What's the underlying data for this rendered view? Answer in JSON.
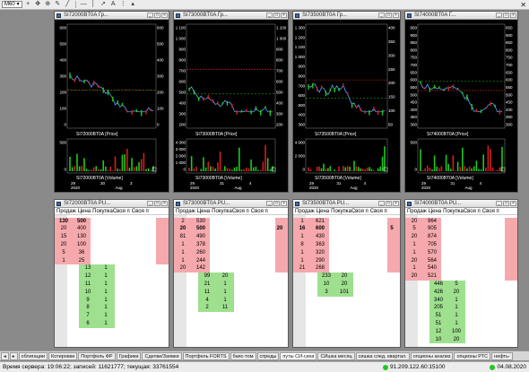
{
  "toolbar": {
    "timeframe": "M60"
  },
  "windows": [
    {
      "title": "SI72000BT0A Гр...",
      "price_legend": "SI72000BT0A [Price]",
      "volume_legend": "SI72000BT0A [Volume]",
      "price_ticks_left": [
        "600",
        "500",
        "400",
        "300",
        "200",
        "100",
        "0"
      ],
      "price_ticks_right": [
        "600",
        "500",
        "400",
        "300",
        "200",
        "100",
        "0"
      ],
      "vol_ticks": [
        "500",
        "0"
      ],
      "date_ticks": [
        "29",
        "30",
        "3"
      ],
      "date_bottom": [
        "2020",
        "Aug"
      ]
    },
    {
      "title": "SI73000BT0A Гр...",
      "price_legend": "SI73000BT0A [Price]",
      "volume_legend": "SI73000BT0A [Volume]",
      "price_ticks_left": [
        "1 100",
        "1 000",
        "900",
        "800",
        "700",
        "600",
        "500",
        "400",
        "300",
        "200"
      ],
      "price_ticks_right": [
        "1 100",
        "1 000",
        "900",
        "800",
        "700",
        "600",
        "500",
        "400",
        "300",
        "200"
      ],
      "vol_ticks": [
        "4 000",
        "3 000",
        "2 000",
        "1 000",
        "0"
      ],
      "date_ticks": [
        "29",
        "31",
        "4"
      ],
      "date_bottom": [
        "2020",
        "Aug"
      ]
    },
    {
      "title": "SI73500BT0A Гр...",
      "price_legend": "SI73500BT0A [Price]",
      "volume_legend": "SI73500BT0A [Volume]",
      "price_ticks_left": [
        "1 300",
        "1 200",
        "1 100",
        "1 000",
        "900",
        "800",
        "700",
        "600",
        "500",
        "400",
        "300"
      ],
      "price_ticks_right": [
        "400",
        "350",
        "300",
        "250",
        "200",
        "150",
        "100",
        "50"
      ],
      "vol_ticks": [
        "4 000",
        "2 000",
        "0"
      ],
      "date_ticks": [
        "29",
        "31",
        "4"
      ],
      "date_bottom": [
        "2020",
        "Aug"
      ]
    },
    {
      "title": "SI74000BT0A Г...",
      "price_legend": "SI74000BT0A [Price]",
      "volume_legend": "SI74000BT0A [Volume]",
      "price_ticks_left": [
        "950",
        "900",
        "850",
        "800",
        "750",
        "700",
        "650",
        "600",
        "550",
        "500",
        "450",
        "400",
        "350",
        "300"
      ],
      "price_ticks_right": [
        "950",
        "900",
        "850",
        "800",
        "750",
        "700",
        "650",
        "600",
        "550",
        "500",
        "450",
        "400",
        "350",
        "300"
      ],
      "vol_ticks": [
        "500",
        "0"
      ],
      "date_ticks": [
        "29",
        "31",
        "4"
      ],
      "date_bottom": [
        "2020",
        "Aug"
      ]
    }
  ],
  "orderbooks": [
    {
      "title": "SI72000BT0A PU...",
      "headers": [
        "Продаж",
        "Цена",
        "ПокупкаСвоя п",
        "Своя п"
      ],
      "asks": [
        [
          "130",
          "500"
        ],
        [
          "20",
          "400"
        ],
        [
          "15",
          "130"
        ],
        [
          "20",
          "100"
        ],
        [
          "5",
          "36"
        ],
        [
          "1",
          "25"
        ]
      ],
      "bids": [
        [
          "13",
          "1"
        ],
        [
          "12",
          "1"
        ],
        [
          "11",
          "1"
        ],
        [
          "10",
          "1"
        ],
        [
          "9",
          "1"
        ],
        [
          "8",
          "1"
        ],
        [
          "7",
          "1"
        ],
        [
          "6",
          "1"
        ]
      ]
    },
    {
      "title": "SI73000BT0A PU...",
      "headers": [
        "Продаж",
        "Цена",
        "ПокупкаСвоя п",
        "Своя п"
      ],
      "asks": [
        [
          "2",
          "530"
        ],
        [
          "20",
          "500"
        ],
        [
          "81",
          "490"
        ],
        [
          "1",
          "378"
        ],
        [
          "1",
          "260"
        ],
        [
          "1",
          "244"
        ],
        [
          "20",
          "142"
        ]
      ],
      "ask_own": "20",
      "bids": [
        [
          "99",
          "20"
        ],
        [
          "21",
          "1"
        ],
        [
          "11",
          "1"
        ],
        [
          "4",
          "1"
        ],
        [
          "2",
          "11"
        ]
      ]
    },
    {
      "title": "SI73500BT0A PU...",
      "headers": [
        "Продаж",
        "Цена",
        "ПокупкаСвоя п",
        "Своя п"
      ],
      "asks": [
        [
          "1",
          "621"
        ],
        [
          "16",
          "600"
        ],
        [
          "1",
          "430"
        ],
        [
          "8",
          "363"
        ],
        [
          "1",
          "320"
        ],
        [
          "1",
          "290"
        ],
        [
          "21",
          "268"
        ]
      ],
      "ask_own": "5",
      "bids": [
        [
          "233",
          "20"
        ],
        [
          "10",
          "20"
        ],
        [
          "3",
          "101"
        ]
      ]
    },
    {
      "title": "SI74000BT0A PU...",
      "headers": [
        "Продаж",
        "Цена",
        "ПокупкаСвоя п",
        "Своя п"
      ],
      "asks": [
        [
          "20",
          "964"
        ],
        [
          "5",
          "905"
        ],
        [
          "20",
          "874"
        ],
        [
          "1",
          "705"
        ],
        [
          "1",
          "570"
        ],
        [
          "20",
          "564"
        ],
        [
          "1",
          "540"
        ],
        [
          "20",
          "521"
        ]
      ],
      "bids": [
        [
          "446",
          "5"
        ],
        [
          "426",
          "20"
        ],
        [
          "340",
          "1"
        ],
        [
          "205",
          "1"
        ],
        [
          "51",
          "1"
        ],
        [
          "51",
          "1"
        ],
        [
          "12",
          "100"
        ],
        [
          "10",
          "20"
        ]
      ]
    }
  ],
  "bottom_tabs": [
    "облигации",
    "Котировки",
    "Портфель ФР",
    "Графики",
    "Сделки/Заявки",
    "Портфель FORTS",
    "баяс-том",
    "спреды",
    "путы СИ-сиха",
    "СИшка месяц",
    "сишка след. квартал.",
    "опционы анализ",
    "опционы РТС",
    "нефть-"
  ],
  "status": {
    "server_time": "Время сервера: 19:06:22; записей: 11621777; текущая: 33761554",
    "ip": "91.209.122.60:15100",
    "date": "04.08.2020"
  },
  "colors": {
    "chart_bg": "#000000",
    "price_line": "#5aa0ff",
    "up_bar": "#1ec81e",
    "down_bar": "#d21e1e",
    "ask_row": "#f6a9ad",
    "bid_row": "#9ee08e",
    "conn_ok": "#1ec81e"
  }
}
